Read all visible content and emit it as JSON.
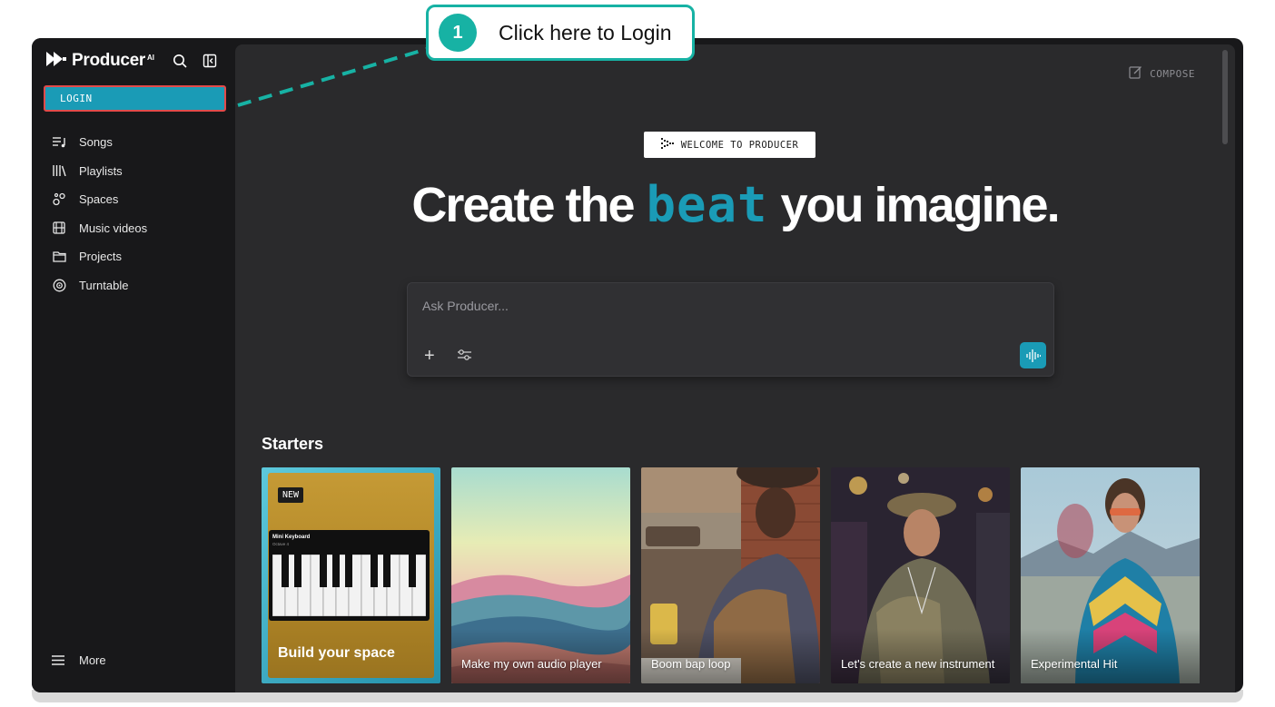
{
  "app": {
    "brand_name": "Producer",
    "brand_sup": "AI"
  },
  "sidebar": {
    "login_label": "LOGIN",
    "items": [
      {
        "label": "Songs",
        "icon": "songs-icon"
      },
      {
        "label": "Playlists",
        "icon": "playlists-icon"
      },
      {
        "label": "Spaces",
        "icon": "spaces-icon"
      },
      {
        "label": "Music videos",
        "icon": "film-icon"
      },
      {
        "label": "Projects",
        "icon": "folder-icon"
      },
      {
        "label": "Turntable",
        "icon": "turntable-icon"
      }
    ],
    "more_label": "More"
  },
  "header": {
    "compose_label": "COMPOSE"
  },
  "hero": {
    "badge": "WELCOME TO PRODUCER",
    "headline_before": "Create the",
    "headline_accent": "beat",
    "headline_after": "you imagine."
  },
  "ask": {
    "placeholder": "Ask Producer..."
  },
  "starters": {
    "title": "Starters",
    "cards": [
      {
        "label": "Build your space",
        "badge": "NEW",
        "widget_title": "Mini Keyboard",
        "widget_sub": "Octave 4"
      },
      {
        "label": "Make my own audio player"
      },
      {
        "label": "Boom bap loop"
      },
      {
        "label": "Let's create a new instrument"
      },
      {
        "label": "Experimental Hit"
      }
    ]
  },
  "callout": {
    "number": "1",
    "text": "Click here to Login"
  },
  "colors": {
    "accent": "#1a9bb6",
    "callout": "#17b2a4",
    "highlight_border": "#e24a4a",
    "sidebar_bg": "#18181a",
    "main_bg": "#2a2a2c"
  }
}
